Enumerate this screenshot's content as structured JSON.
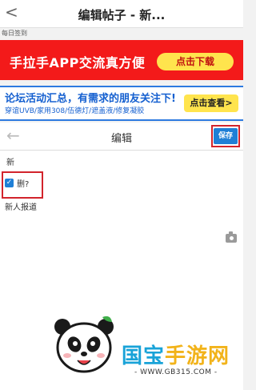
{
  "topbar": {
    "back": "<",
    "title": "编辑帖子 - 新..."
  },
  "signin": "每日签到",
  "ad_banner_1": {
    "text": "手拉手APP交流真方便",
    "button": "点击下载"
  },
  "ad_banner_2": {
    "line1": "论坛活动汇总，有需求的朋友关注下!",
    "line2": "穿谊UVB/家用308/伍德灯/遮盖液/修复凝胶",
    "button": "点击查看>"
  },
  "editor": {
    "back_arrow": "←",
    "title": "编辑",
    "save_label": "保存"
  },
  "form": {
    "forum_name": "新",
    "checkbox_label": "删?",
    "checkbox_checked": true,
    "post_title": "新人报道"
  },
  "watermark": {
    "brand_part1": "国宝",
    "brand_part2": "手游网",
    "url": "- WWW.GB315.COM -"
  },
  "colors": {
    "accent_red": "#d2242c",
    "primary_blue": "#1f7fd6",
    "ad_red": "#f31a1a",
    "ad_yellow": "#ffe44d"
  }
}
